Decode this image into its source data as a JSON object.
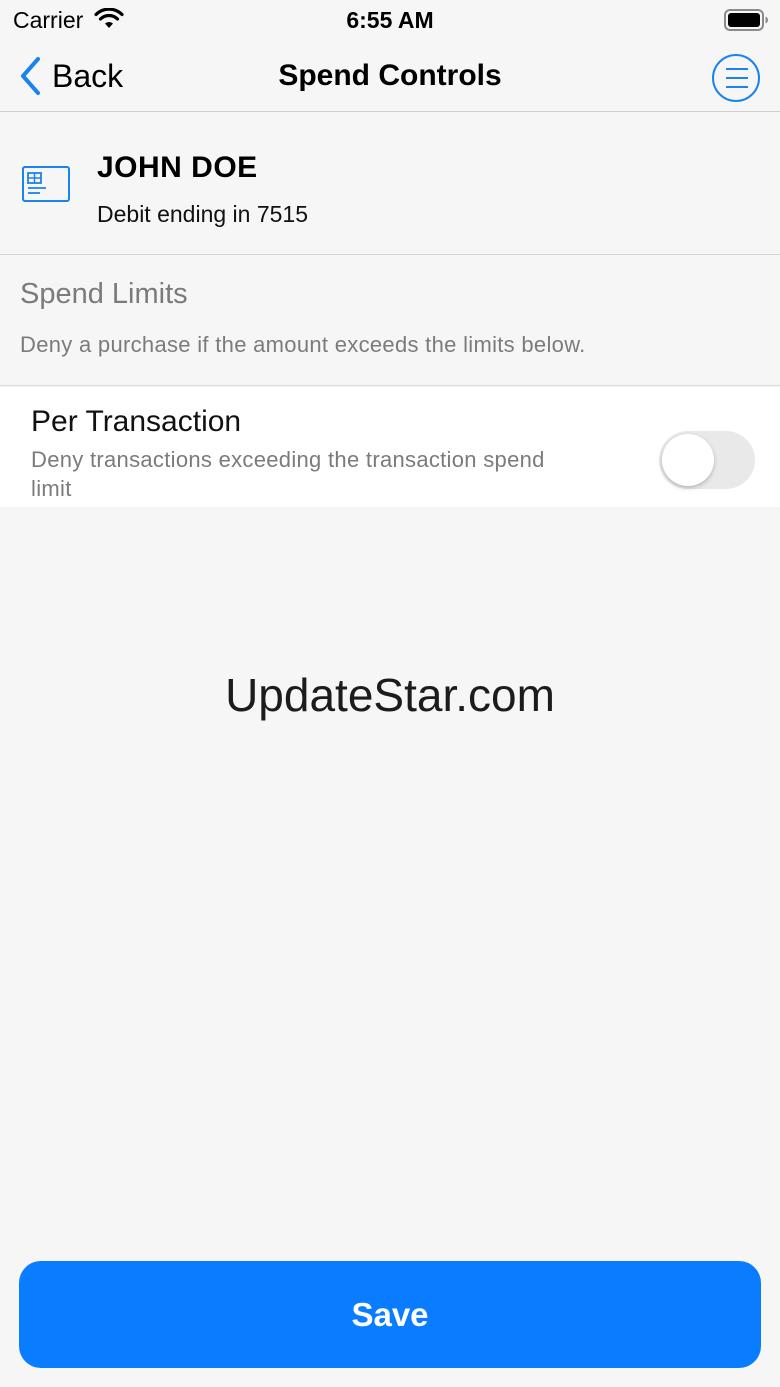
{
  "status_bar": {
    "carrier": "Carrier",
    "time": "6:55 AM",
    "wifi_icon": "wifi-icon",
    "battery_icon": "battery-icon"
  },
  "nav": {
    "back_label": "Back",
    "title": "Spend Controls",
    "menu_icon": "menu-icon"
  },
  "card": {
    "icon": "credit-card-icon",
    "holder": "JOHN DOE",
    "description": "Debit ending in 7515"
  },
  "spend_limits": {
    "title": "Spend Limits",
    "description": "Deny a purchase if the amount exceeds the limits below."
  },
  "per_transaction": {
    "title": "Per Transaction",
    "description": "Deny transactions exceeding the transaction spend limit",
    "enabled": false
  },
  "watermark": "UpdateStar.com",
  "save_label": "Save",
  "colors": {
    "accent": "#0a7cff",
    "icon_blue": "#1a84ec",
    "secondary_text": "#7b7b7b",
    "background": "#f6f6f6"
  }
}
